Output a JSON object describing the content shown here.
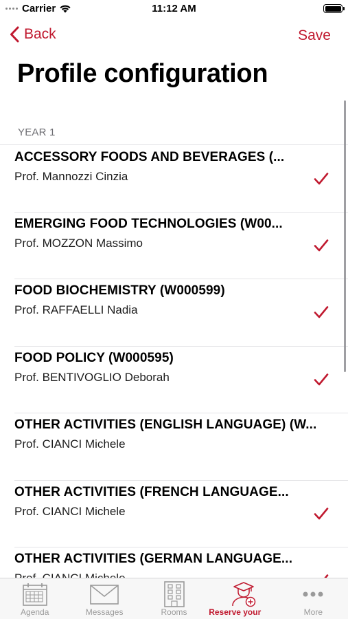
{
  "status_bar": {
    "carrier": "Carrier",
    "time": "11:12 AM"
  },
  "nav": {
    "back_label": "Back",
    "save_label": "Save"
  },
  "title": "Profile configuration",
  "section": {
    "header": "YEAR 1"
  },
  "courses": [
    {
      "title": "ACCESSORY FOODS AND BEVERAGES (...",
      "professor": "Prof. Mannozzi Cinzia",
      "selected": true
    },
    {
      "title": "EMERGING FOOD TECHNOLOGIES (W00...",
      "professor": "Prof. MOZZON Massimo",
      "selected": true
    },
    {
      "title": "FOOD BIOCHEMISTRY (W000599)",
      "professor": "Prof. RAFFAELLI Nadia",
      "selected": true
    },
    {
      "title": "FOOD POLICY (W000595)",
      "professor": "Prof. BENTIVOGLIO Deborah",
      "selected": true
    },
    {
      "title": "OTHER ACTIVITIES (ENGLISH LANGUAGE) (W...",
      "professor": "Prof. CIANCI Michele",
      "selected": false
    },
    {
      "title": "OTHER ACTIVITIES (FRENCH LANGUAGE...",
      "professor": "Prof. CIANCI Michele",
      "selected": true
    },
    {
      "title": "OTHER ACTIVITIES (GERMAN LANGUAGE...",
      "professor": "Prof. CIANCI Michele",
      "selected": true
    }
  ],
  "tabs": [
    {
      "label": "Agenda",
      "icon": "calendar-icon",
      "active": false
    },
    {
      "label": "Messages",
      "icon": "envelope-icon",
      "active": false
    },
    {
      "label": "Rooms",
      "icon": "building-icon",
      "active": false
    },
    {
      "label": "Reserve your seat",
      "icon": "student-add-icon",
      "active": true
    },
    {
      "label": "More",
      "icon": "more-icon",
      "active": false
    }
  ],
  "colors": {
    "accent": "#c0192f",
    "inactive_tab": "#9a9a9a",
    "separator": "#e3e3e6"
  }
}
